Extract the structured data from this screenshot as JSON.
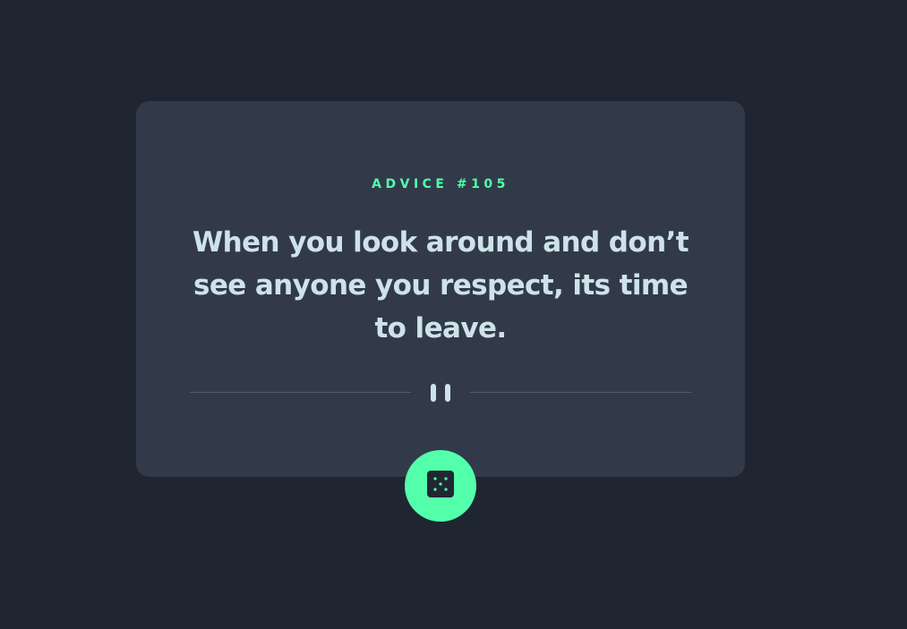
{
  "advice": {
    "label": "ADVICE #105",
    "quote": "When you look around and don’t see anyone you respect, its time to leave."
  },
  "icons": {
    "divider": "pause-icon",
    "button": "dice-icon"
  },
  "colors": {
    "background": "#1f2631",
    "card": "#323a49",
    "accent": "#53ffaa",
    "text": "#cee3e9",
    "divider_line": "#4f5d74"
  }
}
